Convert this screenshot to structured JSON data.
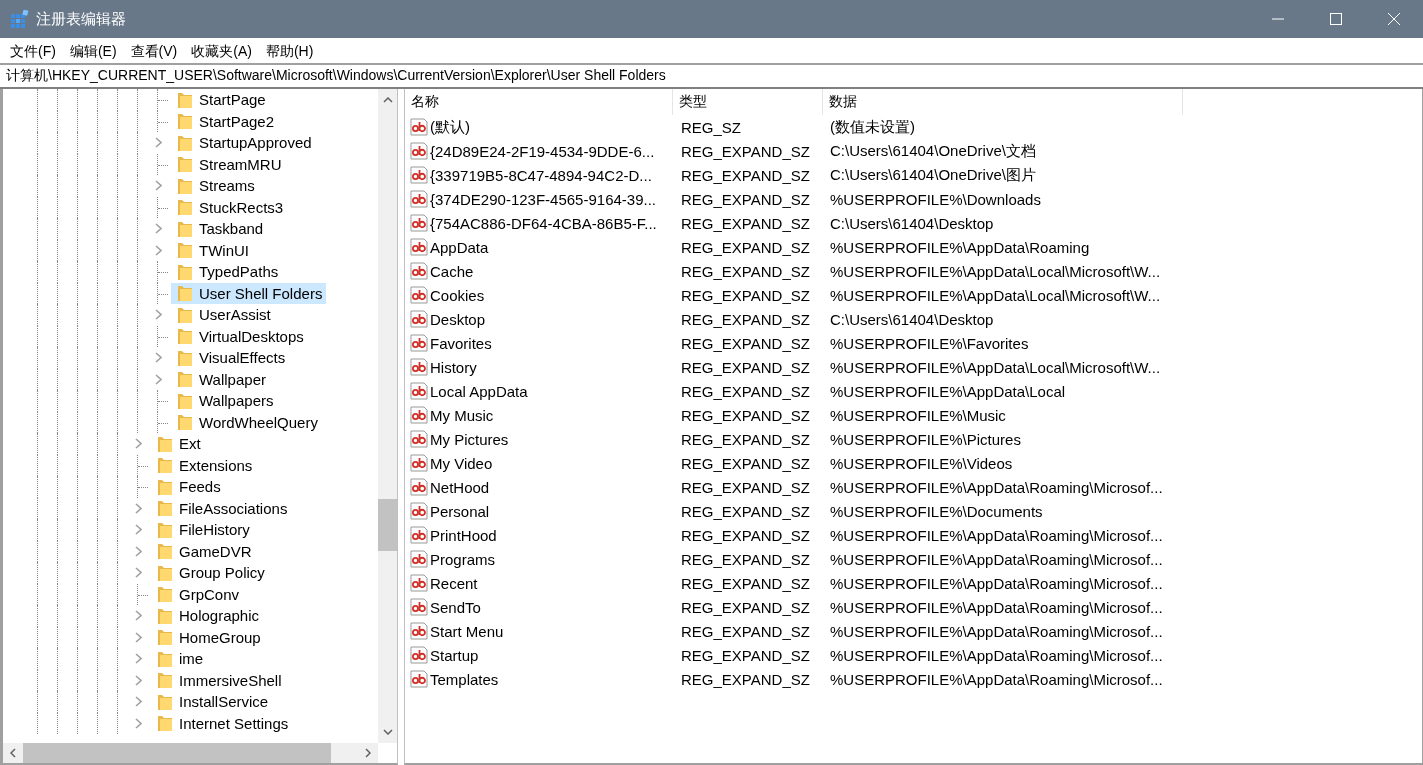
{
  "window": {
    "title": "注册表编辑器"
  },
  "menu": [
    "文件(F)",
    "编辑(E)",
    "查看(V)",
    "收藏夹(A)",
    "帮助(H)"
  ],
  "address": "计算机\\HKEY_CURRENT_USER\\Software\\Microsoft\\Windows\\CurrentVersion\\Explorer\\User Shell Folders",
  "tree": {
    "items": [
      {
        "children": [
          {
            "label": "StartPage",
            "expandable": false,
            "selected": false
          },
          {
            "label": "StartPage2",
            "expandable": false,
            "selected": false
          },
          {
            "label": "StartupApproved",
            "expandable": true,
            "selected": false
          },
          {
            "label": "StreamMRU",
            "expandable": false,
            "selected": false
          },
          {
            "label": "Streams",
            "expandable": true,
            "selected": false
          },
          {
            "label": "StuckRects3",
            "expandable": false,
            "selected": false
          },
          {
            "label": "Taskband",
            "expandable": true,
            "selected": false
          },
          {
            "label": "TWinUI",
            "expandable": true,
            "selected": false
          },
          {
            "label": "TypedPaths",
            "expandable": false,
            "selected": false
          },
          {
            "label": "User Shell Folders",
            "expandable": false,
            "selected": true
          },
          {
            "label": "UserAssist",
            "expandable": true,
            "selected": false
          },
          {
            "label": "VirtualDesktops",
            "expandable": false,
            "selected": false
          },
          {
            "label": "VisualEffects",
            "expandable": true,
            "selected": false
          },
          {
            "label": "Wallpaper",
            "expandable": true,
            "selected": false
          },
          {
            "label": "Wallpapers",
            "expandable": false,
            "selected": false
          },
          {
            "label": "WordWheelQuery",
            "expandable": false,
            "selected": false
          }
        ]
      },
      {
        "label": "Ext",
        "expandable": true,
        "selected": false
      },
      {
        "label": "Extensions",
        "expandable": false,
        "selected": false
      },
      {
        "label": "Feeds",
        "expandable": false,
        "selected": false
      },
      {
        "label": "FileAssociations",
        "expandable": true,
        "selected": false
      },
      {
        "label": "FileHistory",
        "expandable": true,
        "selected": false
      },
      {
        "label": "GameDVR",
        "expandable": true,
        "selected": false
      },
      {
        "label": "Group Policy",
        "expandable": true,
        "selected": false
      },
      {
        "label": "GrpConv",
        "expandable": false,
        "selected": false
      },
      {
        "label": "Holographic",
        "expandable": true,
        "selected": false
      },
      {
        "label": "HomeGroup",
        "expandable": true,
        "selected": false
      },
      {
        "label": "ime",
        "expandable": true,
        "selected": false
      },
      {
        "label": "ImmersiveShell",
        "expandable": true,
        "selected": false
      },
      {
        "label": "InstallService",
        "expandable": true,
        "selected": false
      },
      {
        "label": "Internet Settings",
        "expandable": true,
        "selected": false
      }
    ]
  },
  "table": {
    "columns": [
      "名称",
      "类型",
      "数据"
    ],
    "rows": [
      [
        "(默认)",
        "REG_SZ",
        "(数值未设置)"
      ],
      [
        "{24D89E24-2F19-4534-9DDE-6...",
        "REG_EXPAND_SZ",
        "C:\\Users\\61404\\OneDrive\\文档"
      ],
      [
        "{339719B5-8C47-4894-94C2-D...",
        "REG_EXPAND_SZ",
        "C:\\Users\\61404\\OneDrive\\图片"
      ],
      [
        "{374DE290-123F-4565-9164-39...",
        "REG_EXPAND_SZ",
        "%USERPROFILE%\\Downloads"
      ],
      [
        "{754AC886-DF64-4CBA-86B5-F...",
        "REG_EXPAND_SZ",
        "C:\\Users\\61404\\Desktop"
      ],
      [
        "AppData",
        "REG_EXPAND_SZ",
        "%USERPROFILE%\\AppData\\Roaming"
      ],
      [
        "Cache",
        "REG_EXPAND_SZ",
        "%USERPROFILE%\\AppData\\Local\\Microsoft\\W..."
      ],
      [
        "Cookies",
        "REG_EXPAND_SZ",
        "%USERPROFILE%\\AppData\\Local\\Microsoft\\W..."
      ],
      [
        "Desktop",
        "REG_EXPAND_SZ",
        "C:\\Users\\61404\\Desktop"
      ],
      [
        "Favorites",
        "REG_EXPAND_SZ",
        "%USERPROFILE%\\Favorites"
      ],
      [
        "History",
        "REG_EXPAND_SZ",
        "%USERPROFILE%\\AppData\\Local\\Microsoft\\W..."
      ],
      [
        "Local AppData",
        "REG_EXPAND_SZ",
        "%USERPROFILE%\\AppData\\Local"
      ],
      [
        "My Music",
        "REG_EXPAND_SZ",
        "%USERPROFILE%\\Music"
      ],
      [
        "My Pictures",
        "REG_EXPAND_SZ",
        "%USERPROFILE%\\Pictures"
      ],
      [
        "My Video",
        "REG_EXPAND_SZ",
        "%USERPROFILE%\\Videos"
      ],
      [
        "NetHood",
        "REG_EXPAND_SZ",
        "%USERPROFILE%\\AppData\\Roaming\\Microsof..."
      ],
      [
        "Personal",
        "REG_EXPAND_SZ",
        "%USERPROFILE%\\Documents"
      ],
      [
        "PrintHood",
        "REG_EXPAND_SZ",
        "%USERPROFILE%\\AppData\\Roaming\\Microsof..."
      ],
      [
        "Programs",
        "REG_EXPAND_SZ",
        "%USERPROFILE%\\AppData\\Roaming\\Microsof..."
      ],
      [
        "Recent",
        "REG_EXPAND_SZ",
        "%USERPROFILE%\\AppData\\Roaming\\Microsof..."
      ],
      [
        "SendTo",
        "REG_EXPAND_SZ",
        "%USERPROFILE%\\AppData\\Roaming\\Microsof..."
      ],
      [
        "Start Menu",
        "REG_EXPAND_SZ",
        "%USERPROFILE%\\AppData\\Roaming\\Microsof..."
      ],
      [
        "Startup",
        "REG_EXPAND_SZ",
        "%USERPROFILE%\\AppData\\Roaming\\Microsof..."
      ],
      [
        "Templates",
        "REG_EXPAND_SZ",
        "%USERPROFILE%\\AppData\\Roaming\\Microsof..."
      ]
    ]
  }
}
